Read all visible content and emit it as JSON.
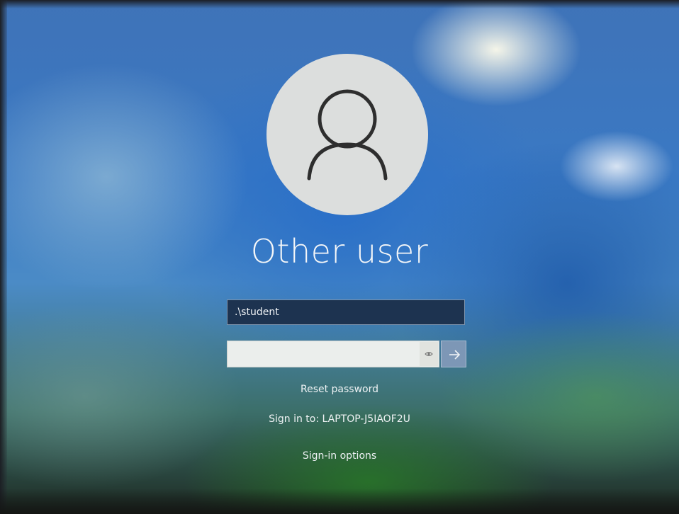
{
  "user": {
    "name": "Other user",
    "avatar_icon": "user-silhouette-icon"
  },
  "form": {
    "username_value": ".\\student",
    "password_value": "",
    "reveal_icon": "eye-icon",
    "submit_icon": "arrow-right-icon"
  },
  "links": {
    "reset_password": "Reset password",
    "sign_in_to": "Sign in to: LAPTOP-J5IAOF2U",
    "sign_in_options": "Sign-in options"
  },
  "colors": {
    "username_field_bg": "#1d3350",
    "submit_button_bg": "#7d97b6",
    "avatar_bg": "#dcdedd"
  }
}
